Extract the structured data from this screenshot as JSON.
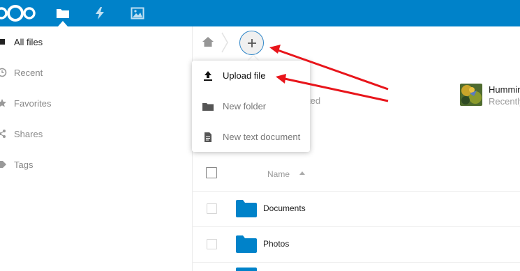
{
  "colors": {
    "brand": "#0082c9",
    "folder": "#0082c9",
    "annotation_arrow": "#e8151b"
  },
  "header": {
    "apps": [
      {
        "name": "Files",
        "icon": "folder-icon"
      },
      {
        "name": "Activity",
        "icon": "lightning-icon"
      },
      {
        "name": "Gallery",
        "icon": "image-icon"
      }
    ]
  },
  "sidebar": {
    "items": [
      {
        "label": "All files",
        "icon": "square-icon",
        "active": true
      },
      {
        "label": "Recent",
        "icon": "clock-icon",
        "active": false
      },
      {
        "label": "Favorites",
        "icon": "star-icon",
        "active": false
      },
      {
        "label": "Shares",
        "icon": "share-icon",
        "active": false
      },
      {
        "label": "Tags",
        "icon": "tag-icon",
        "active": false
      }
    ]
  },
  "breadcrumb": {
    "home_icon": "home-icon",
    "add_icon": "plus-icon"
  },
  "new_menu": {
    "items": [
      {
        "label": "Upload file",
        "icon": "upload-icon"
      },
      {
        "label": "New folder",
        "icon": "folder-icon"
      },
      {
        "label": "New text document",
        "icon": "document-icon"
      }
    ]
  },
  "hidden_text": "ted",
  "recent": {
    "name": "Hummir",
    "subtitle": "Recently"
  },
  "file_list": {
    "column_name": "Name",
    "rows": [
      {
        "name": "Documents",
        "type": "folder"
      },
      {
        "name": "Photos",
        "type": "folder"
      }
    ]
  }
}
